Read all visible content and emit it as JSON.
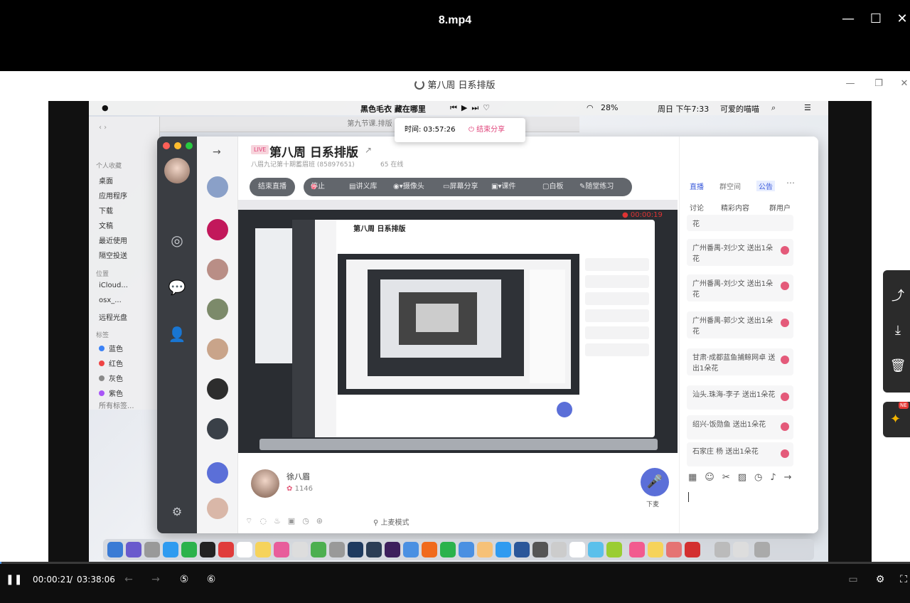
{
  "player": {
    "title": "8.mp4",
    "minimize": "—",
    "maximize": "☐",
    "close": "✕"
  },
  "inner_window": {
    "title": "第八周 日系排版",
    "minimize": "—",
    "restore": "❐",
    "close": "✕"
  },
  "menubar": {
    "song": "黑色毛衣 藏在哪里",
    "battery": "28%",
    "datetime": "周日 下午7:33",
    "user": "可爱的喵喵"
  },
  "finder": {
    "window_title": "第九节课.排版",
    "favorites_label": "个人收藏",
    "favorites": [
      "桌面",
      "应用程序",
      "下载",
      "文稿",
      "最近使用",
      "隔空投送"
    ],
    "locations_label": "位置",
    "locations": [
      "iCloud...",
      "osx_...",
      "远程光盘"
    ],
    "tags_label": "标签",
    "tags": [
      {
        "name": "蓝色",
        "color": "#3b82f6"
      },
      {
        "name": "红色",
        "color": "#ef4444"
      },
      {
        "name": "灰色",
        "color": "#8a8a8a"
      },
      {
        "name": "紫色",
        "color": "#a855f7"
      }
    ],
    "all_tags": "所有标签..."
  },
  "share_popup": {
    "time_label": "时间: 03:57:26",
    "end_button": "结束分享"
  },
  "live": {
    "badge": "LIVE",
    "title": "第八周 日系排版",
    "subtitle": "八眉九记第十期蓄眉班 (85897651)",
    "online": "65 在线",
    "end_button": "结束直播",
    "toolbar": {
      "stop": "停止",
      "lecture": "讲义库",
      "camera": "摄像头",
      "screen_share": "屏幕分享",
      "courseware": "课件",
      "whiteboard": "白板",
      "practice": "随堂练习"
    },
    "video_time": "00:00:19",
    "host_name": "徐八眉",
    "host_flowers": "1146",
    "mic_label": "下麦",
    "mode_label": "上麦模式"
  },
  "right_panel": {
    "tabs": [
      "直播",
      "群空间",
      "公告"
    ],
    "subtabs": [
      "讨论",
      "精彩内容",
      "群用户"
    ],
    "gifts": [
      "花",
      "广州番禺-刘少文 送出1朵花",
      "广州番禺-刘少文 送出1朵花",
      "广州番禺-郭少文 送出1朵花",
      "甘肃·成都蓝鱼捕鲸网卓 送出1朵花",
      "汕头.珠海-李子 送出1朵花",
      "绍兴-饭勋鱼 送出1朵花",
      "石家庄 杨 送出1朵花"
    ]
  },
  "controls": {
    "current_time": "00:00:21",
    "separator": "/",
    "total_time": "03:38:06",
    "progress": 0.0016
  }
}
